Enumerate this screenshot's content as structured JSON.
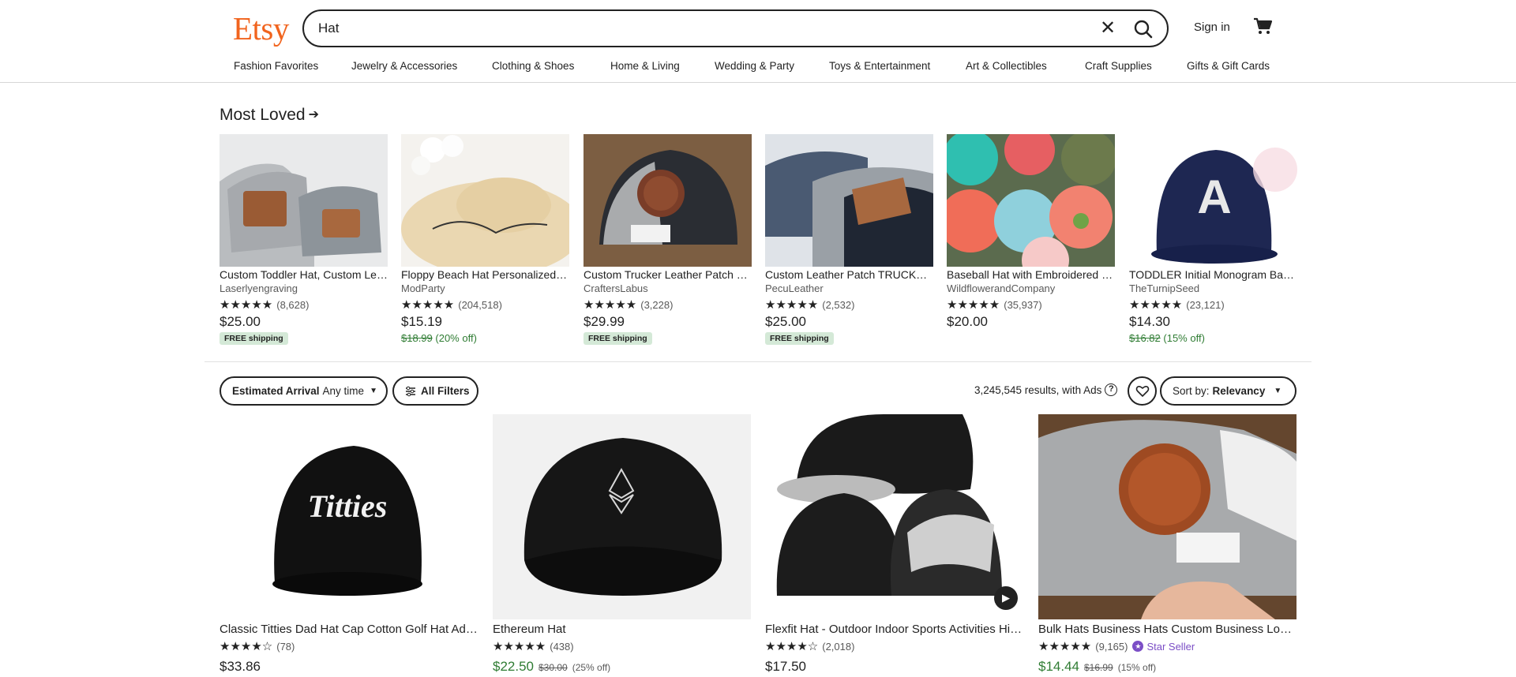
{
  "header": {
    "logo": "Etsy",
    "search_value": "Hat",
    "signin_label": "Sign in",
    "nav": [
      "Fashion Favorites",
      "Jewelry & Accessories",
      "Clothing & Shoes",
      "Home & Living",
      "Wedding & Party",
      "Toys & Entertainment",
      "Art & Collectibles",
      "Craft Supplies",
      "Gifts & Gift Cards"
    ]
  },
  "most_loved": {
    "title": "Most Loved",
    "items": [
      {
        "title": "Custom Toddler Hat, Custom Leather Patch Hat",
        "shop": "Laserlyengraving",
        "stars": "★★★★★",
        "count": "(8,628)",
        "price": "$25.00",
        "badge": "FREE shipping"
      },
      {
        "title": "Floppy Beach Hat Personalized Mrs. Taylor",
        "shop": "ModParty",
        "stars": "★★★★★",
        "count": "(204,518)",
        "price": "$15.19",
        "orig_price": "$18.99",
        "discount": "(20% off)"
      },
      {
        "title": "Custom Trucker Leather Patch Hat",
        "shop": "CraftersLabus",
        "stars": "★★★★★",
        "count": "(3,228)",
        "price": "$29.99",
        "badge": "FREE shipping"
      },
      {
        "title": "Custom Leather Patch TRUCKER Hat",
        "shop": "PecuLeather",
        "stars": "★★★★★",
        "count": "(2,532)",
        "price": "$25.00",
        "badge": "FREE shipping"
      },
      {
        "title": "Baseball Hat with Embroidered Patches",
        "shop": "WildflowerandCompany",
        "stars": "★★★★★",
        "count": "(35,937)",
        "price": "$20.00"
      },
      {
        "title": "TODDLER Initial Monogram Baseball Hat",
        "shop": "TheTurnipSeed",
        "stars": "★★★★★",
        "count": "(23,121)",
        "price": "$14.30",
        "orig_price": "$16.82",
        "discount": "(15% off)"
      }
    ]
  },
  "filters": {
    "arrival_label": "Estimated Arrival",
    "arrival_value": "Any time",
    "all_filters": "All Filters",
    "results_text": "3,245,545 results, with Ads",
    "sort_label": "Sort by:",
    "sort_value": "Relevancy"
  },
  "listings": [
    {
      "title": "Classic Titties Dad Hat Cap Cotton Golf Hat Adjustable",
      "stars": "★★★★☆",
      "count": "(78)",
      "price": "$33.86"
    },
    {
      "title": "Ethereum Hat",
      "stars": "★★★★★",
      "count": "(438)",
      "price": "$22.50",
      "orig_price": "$30.00",
      "discount": "(25% off)"
    },
    {
      "title": "Flexfit Hat - Outdoor Indoor Sports Activities Hiking",
      "stars": "★★★★☆",
      "count": "(2,018)",
      "price": "$17.50"
    },
    {
      "title": "Bulk Hats Business Hats Custom Business Logo Hats",
      "stars": "★★★★★",
      "count": "(9,165)",
      "star_seller": "Star Seller",
      "price": "$14.44",
      "orig_price": "$16.99",
      "discount": "(15% off)"
    }
  ],
  "colors": {
    "brand": "#F1641E",
    "sale": "#2F7C33",
    "free_ship_bg": "#D4E9D7",
    "star_seller": "#7b4ec6"
  }
}
